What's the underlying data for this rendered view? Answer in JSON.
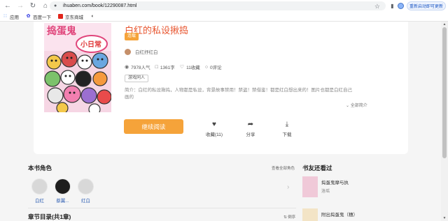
{
  "browser": {
    "url": "ihuaben.com/book/12290087.html",
    "update_button": "重新启动即可更新",
    "bookmarks": [
      {
        "label": "应用",
        "icon": "apps-grid-icon"
      },
      {
        "label": "百度一下",
        "icon": "baidu-icon"
      },
      {
        "label": "京东商城",
        "icon": "jd-icon"
      },
      {
        "label": "",
        "icon": "globe-icon"
      }
    ]
  },
  "book": {
    "title": "白红的私设揪捣",
    "tag": "连载",
    "author": "白红抒红白",
    "stats": [
      {
        "icon": "eye-icon",
        "text": "7978人气"
      },
      {
        "icon": "document-icon",
        "text": "1361字"
      },
      {
        "icon": "heart-icon",
        "text": "11收藏"
      },
      {
        "icon": "comment-icon",
        "text": "0评论"
      }
    ],
    "genre": "游戏同人",
    "intro": "简介：白红的私设揪捣，人物都是私设，背景故事禁用！禁盗！禁借鉴！都是红白想出来的！图片也都是白红自己画的",
    "expand_label": "全部简介",
    "cover_art_text": "小日常"
  },
  "actions": {
    "read": "继续阅读",
    "collect": "收藏(11)",
    "share": "分享",
    "download": "下载"
  },
  "characters_section": {
    "title": "本书角色",
    "link": "查看全部角色",
    "characters": [
      "白红",
      "蔡翼...",
      "红白"
    ]
  },
  "chapters_section": {
    "title": "章节目录(共1章)",
    "sort": "倒序"
  },
  "recommend_section": {
    "title": "书友还看过",
    "items": [
      {
        "name": "捣蛋鬼摩与执",
        "author": "洛瑶"
      },
      {
        "name": "附出捣蛋鬼（穗）",
        "author": ""
      }
    ]
  }
}
